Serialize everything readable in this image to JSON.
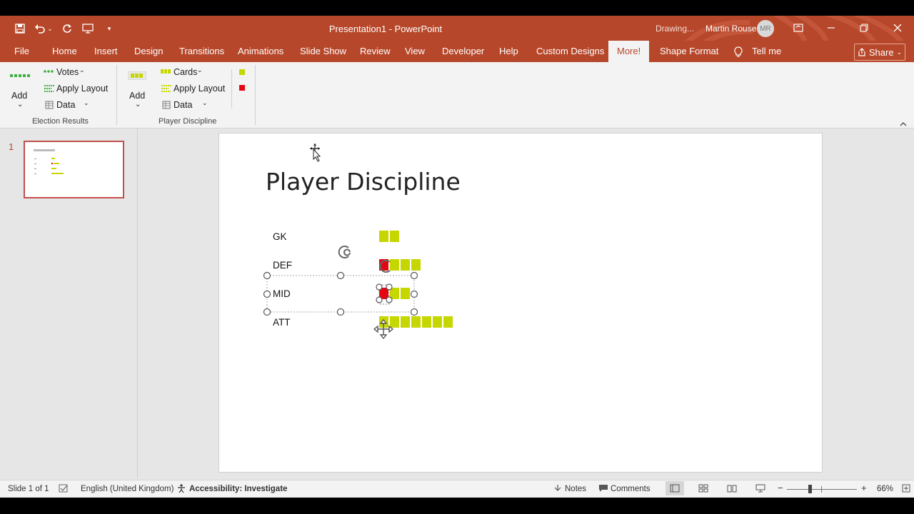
{
  "titlebar": {
    "doc_title": "Presentation1  -  PowerPoint",
    "status": "Drawing...",
    "user_name": "Martin Rouse",
    "user_initials": "MR"
  },
  "tabs": [
    {
      "label": "File"
    },
    {
      "label": "Home"
    },
    {
      "label": "Insert"
    },
    {
      "label": "Design"
    },
    {
      "label": "Transitions"
    },
    {
      "label": "Animations"
    },
    {
      "label": "Slide Show"
    },
    {
      "label": "Review"
    },
    {
      "label": "View"
    },
    {
      "label": "Developer"
    },
    {
      "label": "Help"
    },
    {
      "label": "Custom Designs"
    },
    {
      "label": "More!"
    },
    {
      "label": "Shape Format"
    }
  ],
  "tell_me": "Tell me",
  "share_label": "Share",
  "ribbon": {
    "election": {
      "add_label": "Add",
      "votes_label": "Votes",
      "apply_layout_label": "Apply Layout",
      "data_label": "Data",
      "group_label": "Election Results"
    },
    "player": {
      "add_label": "Add",
      "cards_label": "Cards",
      "apply_layout_label": "Apply Layout",
      "data_label": "Data",
      "group_label": "Player Discipline"
    },
    "colors": {
      "yellow": "#c6d600",
      "red": "#e30613",
      "accent": "#b7472a"
    }
  },
  "thumbnail": {
    "number": "1"
  },
  "slide": {
    "title": "Player Discipline",
    "rows": [
      {
        "label": "GK",
        "cards": [
          "yellow",
          "yellow"
        ]
      },
      {
        "label": "DEF",
        "cards": [
          "red",
          "yellow",
          "yellow",
          "yellow"
        ]
      },
      {
        "label": "MID",
        "cards": [
          "red",
          "yellow",
          "yellow"
        ]
      },
      {
        "label": "ATT",
        "cards": [
          "yellow",
          "yellow",
          "yellow",
          "yellow",
          "yellow",
          "yellow",
          "yellow"
        ]
      }
    ]
  },
  "statusbar": {
    "slide_info": "Slide 1 of 1",
    "language": "English (United Kingdom)",
    "accessibility": "Accessibility: Investigate",
    "notes": "Notes",
    "comments": "Comments",
    "zoom": "66%"
  }
}
